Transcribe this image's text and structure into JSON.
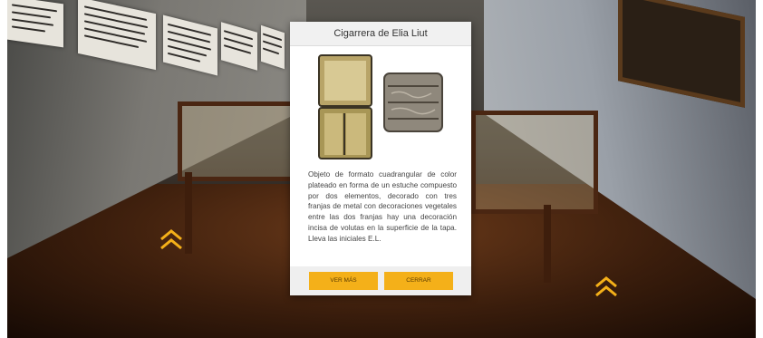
{
  "modal": {
    "title": "Cigarrera de Elia Liut",
    "description": "Objeto de formato cuadrangular de color plateado en forma de un estuche compuesto por dos elementos, decorado con tres franjas de metal con decoraciones vegetales entre las dos franjas hay una decoración incisa de volutas en la superficie de la tapa. Lleva las iniciales E.L.",
    "buttons": {
      "more_label": "VER MÁS",
      "close_label": "CERRAR"
    }
  },
  "scene": {
    "nav_arrows": [
      "chevron-up-icon",
      "chevron-up-icon"
    ],
    "accent_color": "#f4b019"
  }
}
